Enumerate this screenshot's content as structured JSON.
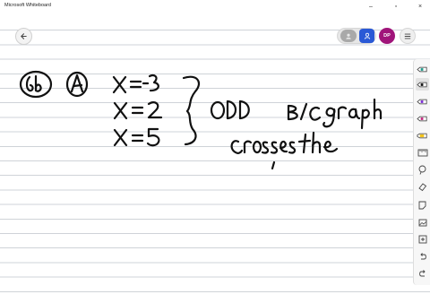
{
  "window": {
    "title": "Microsoft Whiteboard",
    "minimize": "–",
    "maximize": "▫",
    "close": "×"
  },
  "header": {
    "avatar_initials": "DP"
  },
  "toolbar": {
    "tools": [
      {
        "name": "pen-teal",
        "color": "#1f9a8a"
      },
      {
        "name": "pen-black",
        "color": "#111111"
      },
      {
        "name": "pen-purple",
        "color": "#7a2ad6"
      },
      {
        "name": "pen-magenta",
        "color": "#c0267d"
      },
      {
        "name": "highlighter",
        "color": "#f2c21b"
      },
      {
        "name": "ruler",
        "color": "#555555"
      },
      {
        "name": "lasso",
        "color": "#555555"
      },
      {
        "name": "eraser",
        "color": "#555555"
      }
    ]
  }
}
